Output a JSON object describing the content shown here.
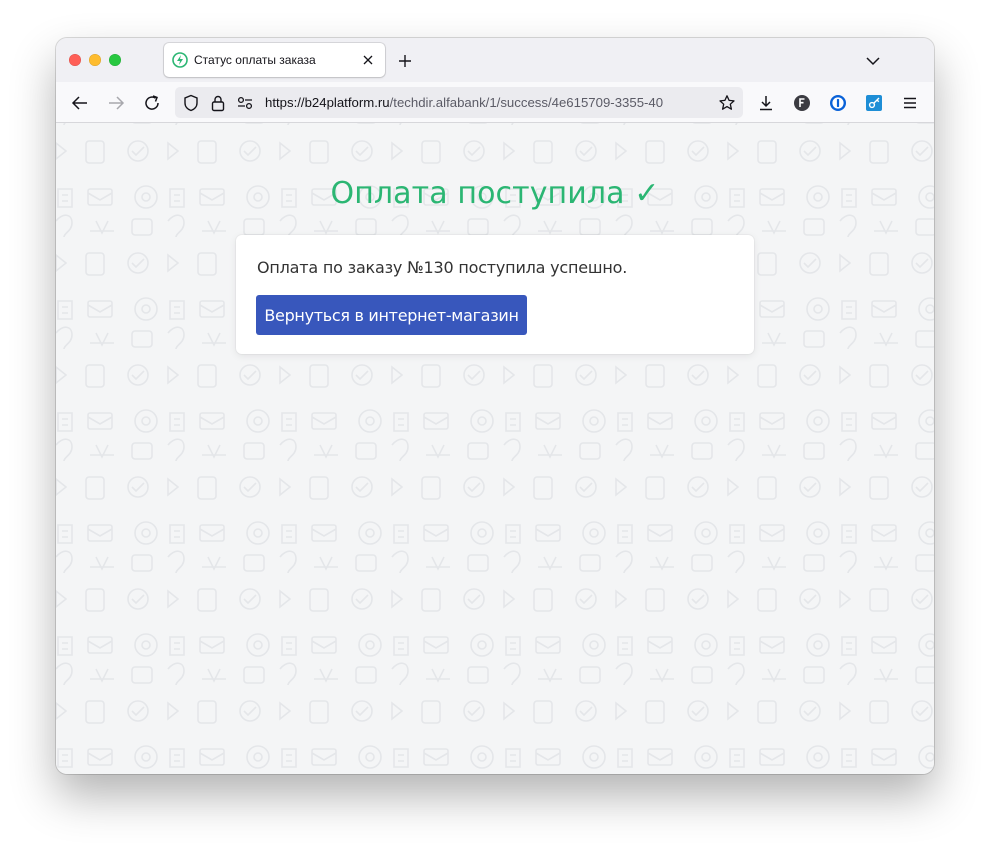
{
  "browser": {
    "tab": {
      "title": "Статус оплаты заказа",
      "favicon": "lightning-icon",
      "favicon_color": "#2bb673"
    },
    "address_bar": {
      "url_host": "https://b24platform.ru",
      "url_path": "/techdir.alfabank/1/success/4e615709-3355-40"
    },
    "toolbar_icons": [
      "back-icon",
      "forward-icon",
      "reload-icon",
      "tracking-shield-icon",
      "lock-icon",
      "permissions-icon",
      "bookmark-star-icon",
      "download-icon",
      "extension-f-icon",
      "password-manager-icon",
      "key-extension-icon",
      "menu-icon"
    ]
  },
  "page": {
    "heading": "Оплата поступила ✓",
    "heading_color": "#2bb673",
    "message": "Оплата по заказу №130 поступила успешно.",
    "button_label": "Вернуться в интернет-магазин",
    "button_color": "#3857bc"
  }
}
